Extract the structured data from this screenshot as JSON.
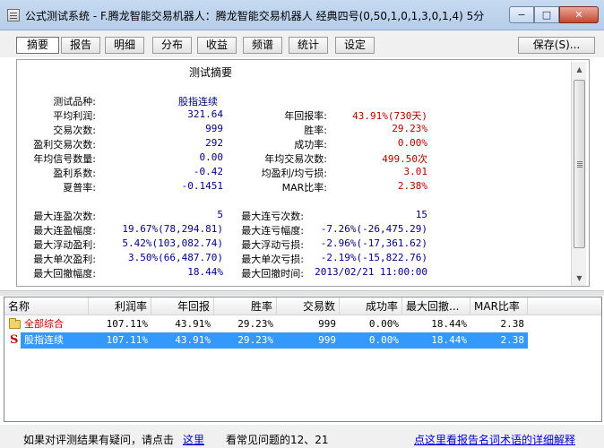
{
  "window": {
    "title": "公式测试系统 - F.腾龙智能交易机器人：腾龙智能交易机器人 经典四号(0,50,1,0,1,3,0,1,4) 5分",
    "minimize_label": "−",
    "maximize_label": "□",
    "close_label": "✕"
  },
  "tabs": [
    {
      "label": "摘要"
    },
    {
      "label": "报告"
    },
    {
      "label": "明细"
    },
    {
      "label": "分布"
    },
    {
      "label": "收益"
    },
    {
      "label": "频谱"
    },
    {
      "label": "统计"
    },
    {
      "label": "设定"
    }
  ],
  "save_label": "保存(S)...",
  "summary": {
    "title": "测试摘要",
    "variety_label": "测试品种:",
    "variety_value": "股指连续",
    "left": [
      {
        "label": "平均利润:",
        "value": "321.64"
      },
      {
        "label": "交易次数:",
        "value": "999"
      },
      {
        "label": "盈利交易次数:",
        "value": "292"
      },
      {
        "label": "年均信号数量:",
        "value": "0.00"
      },
      {
        "label": "盈利系数:",
        "value": "-0.42"
      },
      {
        "label": "夏普率:",
        "value": "-0.1451"
      }
    ],
    "right": [
      {
        "label": "年回报率:",
        "value": "43.91%(730天)"
      },
      {
        "label": "胜率:",
        "value": "29.23%"
      },
      {
        "label": "成功率:",
        "value": "0.00%"
      },
      {
        "label": "年均交易次数:",
        "value": "499.50次"
      },
      {
        "label": "均盈利/均亏损:",
        "value": "3.01"
      },
      {
        "label": "MAR比率:",
        "value": "2.38%"
      }
    ],
    "left2": [
      {
        "label": "最大连盈次数:",
        "value": "5"
      },
      {
        "label": "最大连盈幅度:",
        "value": "19.67%(78,294.81)"
      },
      {
        "label": "最大浮动盈利:",
        "value": "5.42%(103,082.74)"
      },
      {
        "label": "最大单次盈利:",
        "value": "3.50%(66,487.70)"
      },
      {
        "label": "最大回撤幅度:",
        "value": "18.44%"
      }
    ],
    "right2": [
      {
        "label": "最大连亏次数:",
        "value": "15"
      },
      {
        "label": "最大连亏幅度:",
        "value": "-7.26%(-26,475.29)"
      },
      {
        "label": "最大浮动亏损:",
        "value": "-2.96%(-17,361.62)"
      },
      {
        "label": "最大单次亏损:",
        "value": "-2.19%(-15,822.76)"
      },
      {
        "label": "最大回撤时间:",
        "value": "2013/02/21 11:00:00"
      }
    ]
  },
  "table": {
    "columns": [
      "名称",
      "利润率",
      "年回报",
      "胜率",
      "交易数",
      "成功率",
      "最大回撤...",
      "MAR比率"
    ],
    "rows": [
      {
        "icon": "folder-icon",
        "name": "全部综合",
        "cells": [
          "107.11%",
          "43.91%",
          "29.23%",
          "999",
          "0.00%",
          "18.44%",
          "2.38"
        ]
      },
      {
        "icon": "s-icon",
        "icon_glyph": "S",
        "name": "股指连续",
        "cells": [
          "107.11%",
          "43.91%",
          "29.23%",
          "999",
          "0.00%",
          "18.44%",
          "2.38"
        ]
      }
    ]
  },
  "footer": {
    "question_text": "如果对评测结果有疑问，请点击",
    "here_link": "这里",
    "faq_text": "看常见问题的12、21",
    "glossary_link": "点这里看报告名词术语的详细解释"
  },
  "colors": {
    "accent_red": "#b00000",
    "accent_blue": "#000080",
    "selection": "#3399ff"
  }
}
